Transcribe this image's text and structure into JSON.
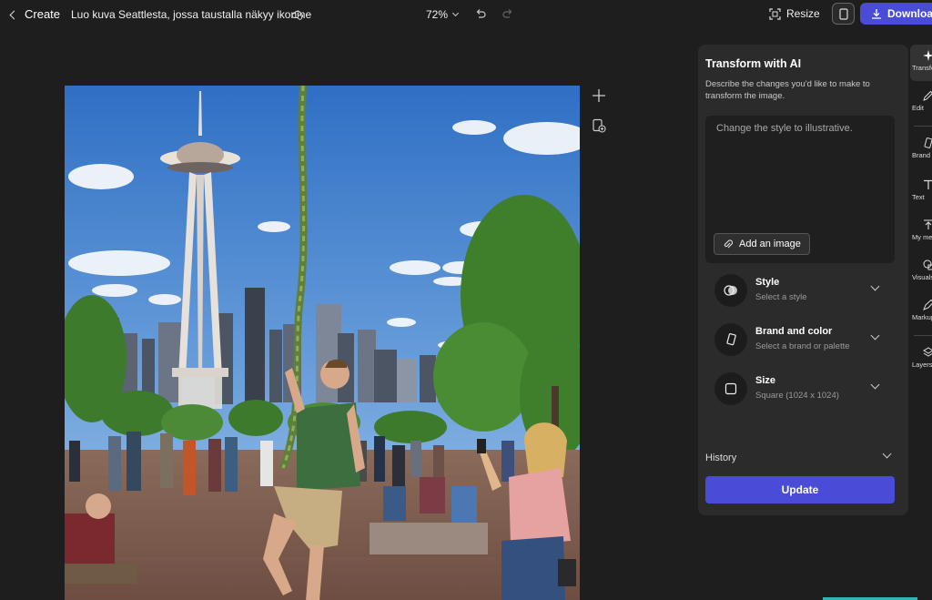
{
  "topbar": {
    "back_label": "Create",
    "doc_title": "Luo kuva Seattlesta, jossa taustalla näkyy ikonine",
    "zoom": "72%",
    "resize_label": "Resize",
    "download_label": "Download"
  },
  "panel": {
    "title": "Transform with AI",
    "description": "Describe the changes you'd like to make to transform the image.",
    "prompt_placeholder": "Change the style to illustrative.",
    "add_image_label": "Add an image",
    "options": [
      {
        "title": "Style",
        "subtitle": "Select a style",
        "icon": "style-circles-icon"
      },
      {
        "title": "Brand and color",
        "subtitle": "Select a brand or palette",
        "icon": "brand-icon"
      },
      {
        "title": "Size",
        "subtitle": "Square (1024 x 1024)",
        "icon": "square-icon"
      }
    ],
    "history_label": "History",
    "update_label": "Update"
  },
  "rail": {
    "items": [
      {
        "label": "Transform",
        "icon": "sparkle-icon"
      },
      {
        "label": "Edit",
        "icon": "pencil-icon"
      },
      {
        "label": "Brand",
        "icon": "brand-icon"
      },
      {
        "label": "Text",
        "icon": "text-icon"
      },
      {
        "label": "My media",
        "icon": "upload-icon"
      },
      {
        "label": "Visuals",
        "icon": "shapes-icon"
      },
      {
        "label": "Markup",
        "icon": "pen-icon"
      },
      {
        "label": "Layers",
        "icon": "layers-icon"
      }
    ]
  },
  "colors": {
    "accent": "#4a4bd6",
    "background": "#1e1e1e",
    "panel": "#2b2b2b"
  }
}
